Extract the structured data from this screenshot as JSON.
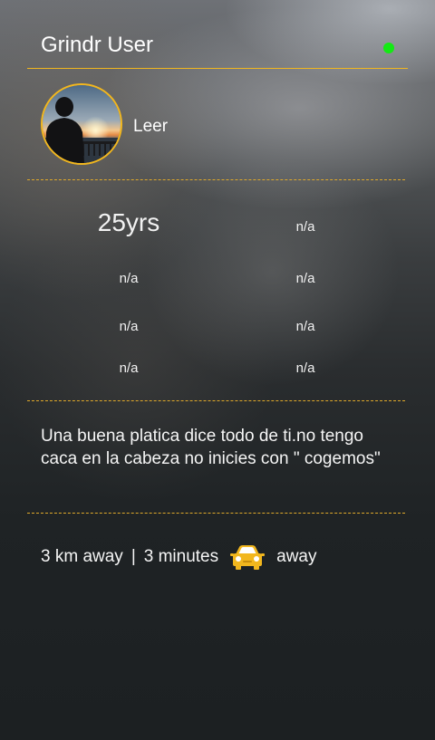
{
  "header": {
    "title": "Grindr User",
    "status_color": "#14ea14"
  },
  "profile": {
    "avatar_icon": "avatar",
    "read_label": "Leer"
  },
  "stats": {
    "age": "25yrs",
    "cells": [
      "n/a",
      "n/a",
      "n/a",
      "n/a",
      "n/a",
      "n/a",
      "n/a"
    ]
  },
  "bio": "Una buena platica dice todo de ti.no tengo caca en la cabeza no inicies con \" cogemos\"",
  "distance": {
    "distance_text": "3 km away",
    "separator": "|",
    "time_text": "3 minutes",
    "icon": "car-icon",
    "suffix": "away"
  },
  "colors": {
    "accent": "#f2b71e",
    "online": "#14ea14"
  }
}
